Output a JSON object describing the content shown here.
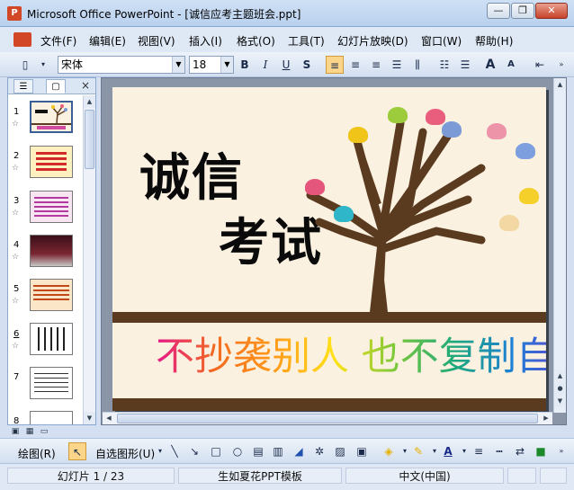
{
  "window": {
    "title": "Microsoft Office PowerPoint - [诚信应考主题班会.ppt]",
    "app_icon": "P"
  },
  "window_controls": {
    "minimize": "—",
    "restore": "❐",
    "close": "✕"
  },
  "menu": {
    "items": [
      "文件(F)",
      "编辑(E)",
      "视图(V)",
      "插入(I)",
      "格式(O)",
      "工具(T)",
      "幻灯片放映(D)",
      "窗口(W)",
      "帮助(H)"
    ]
  },
  "toolbar": {
    "font_name": "宋体",
    "font_size": "18",
    "bold": "B",
    "italic": "I",
    "underline": "U",
    "shadow": "S",
    "grow_font": "A",
    "shrink_font": "A"
  },
  "slides_panel": {
    "slide_numbers": [
      "1",
      "2",
      "3",
      "4",
      "5",
      "6",
      "7",
      "8"
    ],
    "close": "×"
  },
  "slide": {
    "title_line1": "诚信",
    "title_line2": "考试",
    "motto": "不抄袭别人 也不复制自己。",
    "leaf_colors": [
      "#f0c419",
      "#9ccc3c",
      "#e85e7c",
      "#7b9ad6",
      "#ee94a8",
      "#7d9fe0",
      "#f5cf2a",
      "#2fb7c9",
      "#e4567b",
      "#f4d8a3"
    ]
  },
  "draw_toolbar": {
    "draw_label": "绘图(R)",
    "autoshape_label": "自选图形(U)"
  },
  "status": {
    "slide_pos": "幻灯片 1 / 23",
    "design": "生如夏花PPT模板",
    "language": "中文(中国)"
  }
}
